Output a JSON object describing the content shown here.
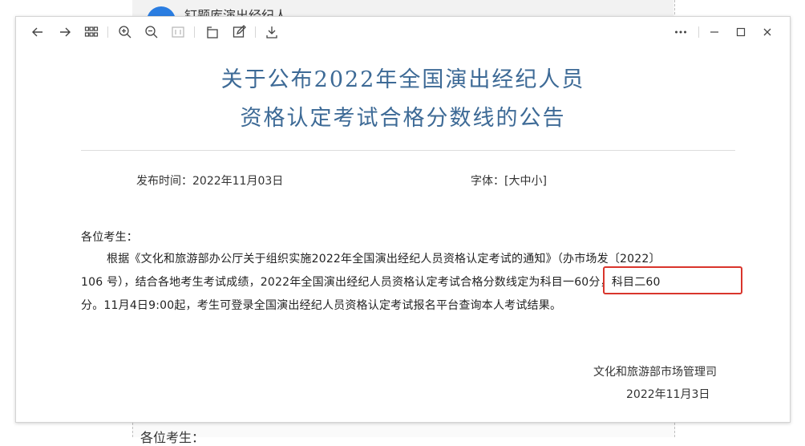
{
  "background_page": {
    "title": "钉题库演出经纪人",
    "body_start": "各位考生："
  },
  "toolbar": {
    "back_icon": "arrow-left-icon",
    "forward_icon": "arrow-right-icon",
    "grid_icon": "thumbnail-grid-icon",
    "zoom_in_icon": "zoom-in-icon",
    "zoom_out_icon": "zoom-out-icon",
    "fit_icon": "fit-page-icon",
    "rotate_icon": "rotate-icon",
    "edit_icon": "edit-icon",
    "download_icon": "download-icon",
    "more_icon": "more-icon",
    "minimize_icon": "minimize-icon",
    "maximize_icon": "maximize-icon",
    "close_icon": "close-icon"
  },
  "document": {
    "title_line1": "关于公布2022年全国演出经纪人员",
    "title_line2": "资格认定考试合格分数线的公告",
    "publish_time": "发布时间：2022年11月03日",
    "font_size_label": "字体：[大中小]",
    "greeting": "各位考生：",
    "paragraph_line1": "根据《文化和旅游部办公厅关于组织实施2022年全国演出经纪人员资格认定考试的通知》（办市场发〔2022〕",
    "paragraph_line2": "106 号），结合各地考生考试成绩，2022年全国演出经纪人员资格认定考试合格分数线定为科目一60分，科目二60",
    "paragraph_line3": "分。11月4日9:00起，考生可登录全国演出经纪人员资格认定考试报名平台查询本人考试结果。",
    "signature_org": "文化和旅游部市场管理司",
    "signature_date": "2022年11月3日"
  },
  "colors": {
    "title": "#3d6a96",
    "highlight_border": "#d9352c"
  }
}
